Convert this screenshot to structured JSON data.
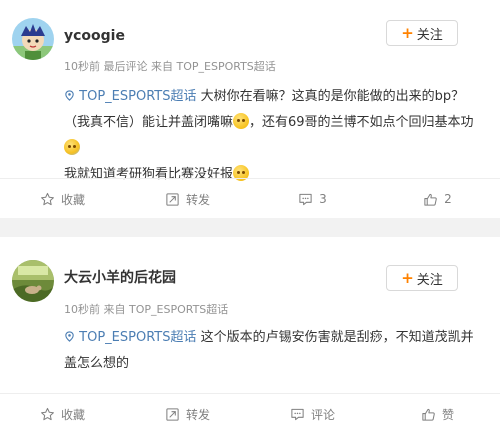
{
  "comments": [
    {
      "username": "ycoogie",
      "time": "10秒前",
      "last_comment": "最后评论",
      "source": "来自 TOP_ESPORTS超话",
      "follow_label": "关注",
      "topic": "TOP_ESPORTS超话",
      "text_1": "大树你在看嘛？这真的是你能做的出来的bp？（我真不信）能让并盖闭嘴嘛",
      "text_2": "，还有69哥的兰博不如点个回归基本功",
      "text_3": "我就知道考研狗看比赛没好报",
      "actions": {
        "favorite": "收藏",
        "repost": "转发",
        "comment": "3",
        "like": "2"
      }
    },
    {
      "username": "大云小羊的后花园",
      "time": "10秒前",
      "source": "来自 TOP_ESPORTS超话",
      "follow_label": "关注",
      "topic": "TOP_ESPORTS超话",
      "text_1": "这个版本的卢锡安伤害就是刮痧，不知道茂凯并盖怎么想的",
      "actions": {
        "favorite": "收藏",
        "repost": "转发",
        "comment": "评论",
        "like": "赞"
      }
    }
  ],
  "colors": {
    "topic": "#4c7eb3",
    "accent": "#ff8200",
    "meta": "#939393",
    "background": "#f2f2f2"
  }
}
